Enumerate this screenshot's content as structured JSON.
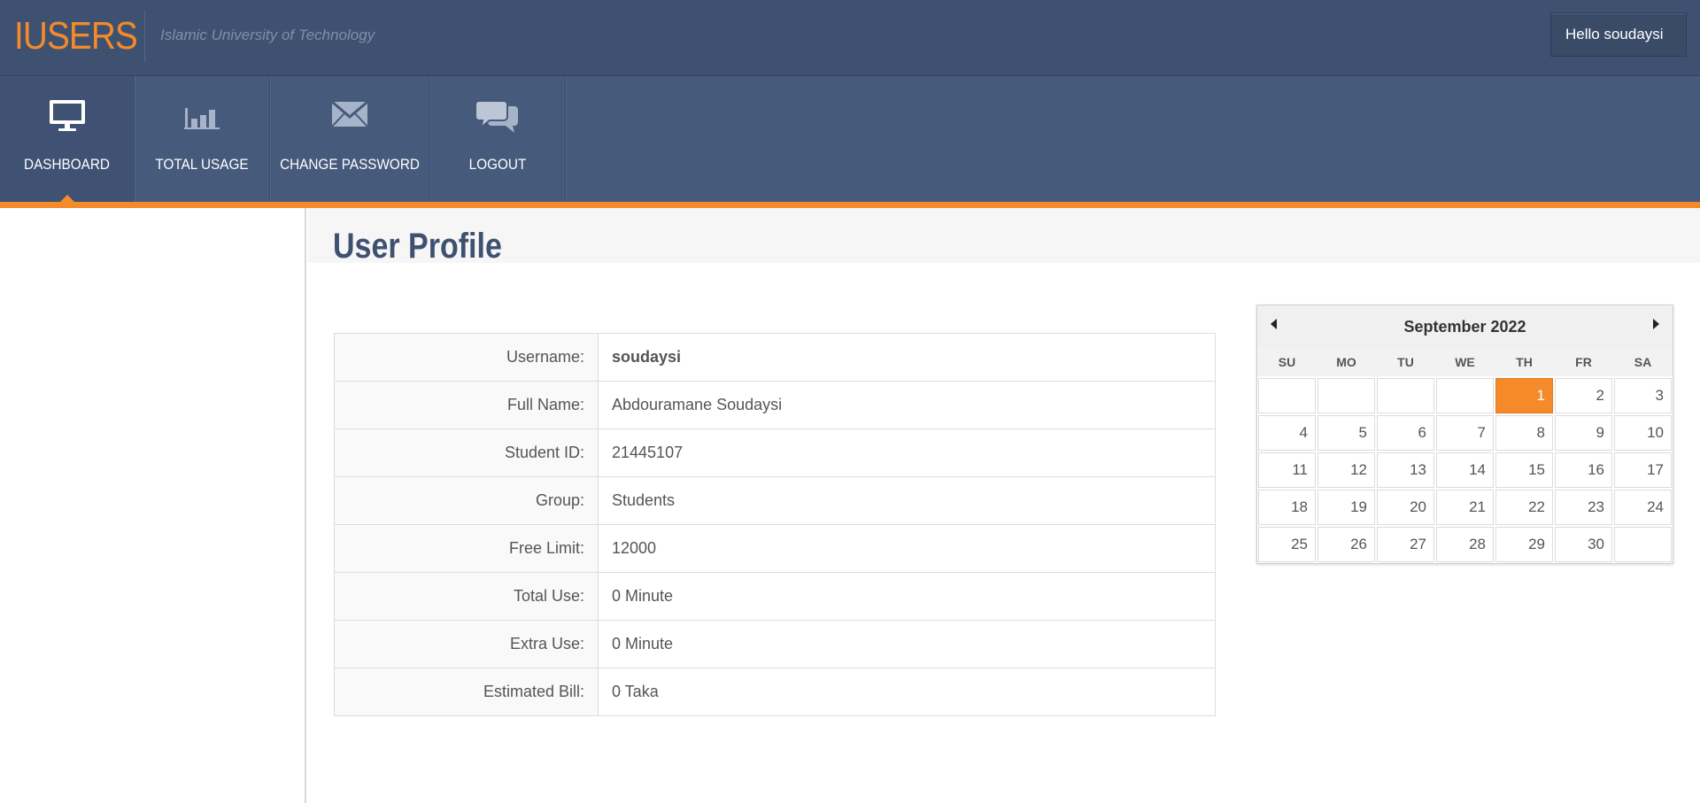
{
  "header": {
    "logo": "IUSERS",
    "tagline": "Islamic University of Technology",
    "greeting": "Hello soudaysi"
  },
  "nav": {
    "items": [
      {
        "label": "DASHBOARD",
        "icon": "monitor-icon",
        "active": true
      },
      {
        "label": "TOTAL USAGE",
        "icon": "bar-chart-icon",
        "active": false
      },
      {
        "label": "CHANGE PASSWORD",
        "icon": "envelope-icon",
        "active": false
      },
      {
        "label": "LOGOUT",
        "icon": "chat-bubbles-icon",
        "active": false
      }
    ]
  },
  "page": {
    "title": "User Profile"
  },
  "profile": {
    "rows": [
      {
        "key": "Username:",
        "value": "soudaysi"
      },
      {
        "key": "Full Name:",
        "value": "Abdouramane Soudaysi"
      },
      {
        "key": "Student ID:",
        "value": "21445107"
      },
      {
        "key": "Group:",
        "value": "Students"
      },
      {
        "key": "Free Limit:",
        "value": "12000"
      },
      {
        "key": "Total Use:",
        "value": "0 Minute"
      },
      {
        "key": "Extra Use:",
        "value": "0 Minute"
      },
      {
        "key": "Estimated Bill:",
        "value": "0 Taka"
      }
    ]
  },
  "calendar": {
    "month": "September 2022",
    "days_of_week": [
      "SU",
      "MO",
      "TU",
      "WE",
      "TH",
      "FR",
      "SA"
    ],
    "first_weekday": 4,
    "days_in_month": 30,
    "today": 1,
    "accent_color": "#f48a2a"
  },
  "colors": {
    "header_bg": "#3f5171",
    "nav_bg": "#465a7c",
    "accent": "#f48a2a",
    "title": "#3f5171"
  }
}
